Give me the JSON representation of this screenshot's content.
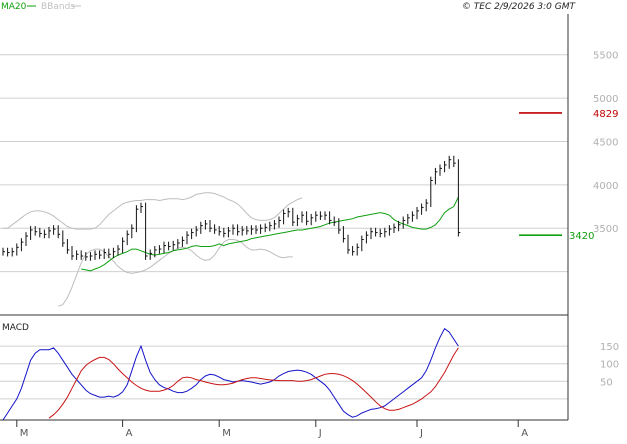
{
  "header": {
    "ma_label": "MA20",
    "bb_label": "BBands",
    "copyright": "© TEC 2/9/2026 3:0 GMT"
  },
  "colors": {
    "price": "#111111",
    "ma20": "#10a010",
    "bbands": "#bdbdbd",
    "resistance": "#c00000",
    "support": "#10a010",
    "grid": "#d0d0d0",
    "axis": "#333333",
    "macd_line": "#1414c8",
    "macd_signal": "#c81414"
  },
  "chart_data": [
    {
      "type": "line",
      "name_label": "price",
      "ylim": [
        2500,
        5900
      ],
      "y_ticks": [
        {
          "value": 5500,
          "label": "5500"
        },
        {
          "value": 5000,
          "label": "5000"
        },
        {
          "value": 4500,
          "label": "4500"
        },
        {
          "value": 4000,
          "label": "4000"
        },
        {
          "value": 3500,
          "label": "3500"
        }
      ],
      "x_ticks": [
        {
          "index": 3,
          "label": "M"
        },
        {
          "index": 26,
          "label": "A"
        },
        {
          "index": 47,
          "label": "M"
        },
        {
          "index": 68,
          "label": "J"
        },
        {
          "index": 90,
          "label": "J"
        },
        {
          "index": 112,
          "label": "A"
        }
      ],
      "price": [
        3230,
        3220,
        3230,
        3280,
        3340,
        3410,
        3480,
        3460,
        3440,
        3430,
        3470,
        3490,
        3430,
        3330,
        3250,
        3180,
        3200,
        3180,
        3170,
        3180,
        3200,
        3190,
        3220,
        3200,
        3230,
        3260,
        3350,
        3430,
        3500,
        3720,
        3750,
        3180,
        3210,
        3250,
        3260,
        3300,
        3290,
        3310,
        3330,
        3360,
        3420,
        3450,
        3480,
        3530,
        3550,
        3500,
        3480,
        3460,
        3440,
        3470,
        3500,
        3460,
        3480,
        3470,
        3490,
        3480,
        3500,
        3510,
        3530,
        3550,
        3590,
        3670,
        3690,
        3570,
        3610,
        3650,
        3580,
        3620,
        3650,
        3640,
        3650,
        3590,
        3570,
        3480,
        3380,
        3250,
        3230,
        3280,
        3370,
        3420,
        3460,
        3450,
        3440,
        3460,
        3490,
        3510,
        3540,
        3590,
        3620,
        3650,
        3700,
        3740,
        3790,
        4050,
        4150,
        4190,
        4230,
        4290,
        4250,
        3450
      ],
      "ma20": [
        3030,
        3020,
        3010,
        3030,
        3050,
        3080,
        3120,
        3160,
        3190,
        3210,
        3230,
        3260,
        3260,
        3240,
        3220,
        3200,
        3190,
        3200,
        3210,
        3220,
        3240,
        3250,
        3260,
        3270,
        3290,
        3300,
        3290,
        3290,
        3290,
        3300,
        3320,
        3300,
        3320,
        3330,
        3340,
        3350,
        3360,
        3380,
        3390,
        3400,
        3410,
        3420,
        3430,
        3440,
        3450,
        3460,
        3470,
        3480,
        3480,
        3490,
        3500,
        3510,
        3520,
        3540,
        3560,
        3570,
        3580,
        3590,
        3600,
        3610,
        3630,
        3640,
        3650,
        3660,
        3670,
        3680,
        3670,
        3650,
        3600,
        3570,
        3550,
        3530,
        3510,
        3500,
        3490,
        3490,
        3510,
        3540,
        3600,
        3680,
        3720,
        3750,
        3860
      ],
      "bb_upper": [
        3500,
        3500,
        3540,
        3580,
        3620,
        3660,
        3690,
        3700,
        3700,
        3690,
        3670,
        3640,
        3600,
        3560,
        3520,
        3500,
        3490,
        3490,
        3490,
        3490,
        3500,
        3540,
        3600,
        3660,
        3700,
        3740,
        3780,
        3800,
        3810,
        3820,
        3820,
        3830,
        3830,
        3830,
        3820,
        3830,
        3840,
        3840,
        3840,
        3830,
        3840,
        3860,
        3890,
        3900,
        3910,
        3910,
        3900,
        3880,
        3860,
        3830,
        3810,
        3780,
        3730,
        3670,
        3620,
        3600,
        3590,
        3590,
        3600,
        3620,
        3670,
        3720,
        3770,
        3800,
        3830,
        3850
      ],
      "bb_lower": [
        2600,
        2620,
        2700,
        2820,
        2960,
        3100,
        3200,
        3240,
        3260,
        3260,
        3230,
        3170,
        3120,
        3060,
        3020,
        2990,
        2980,
        2990,
        3000,
        3020,
        3050,
        3090,
        3130,
        3170,
        3210,
        3240,
        3270,
        3280,
        3270,
        3240,
        3190,
        3150,
        3130,
        3140,
        3190,
        3270,
        3340,
        3370,
        3370,
        3360,
        3330,
        3280,
        3250,
        3250,
        3260,
        3250,
        3230,
        3200,
        3170,
        3160,
        3170,
        3170
      ],
      "levels": [
        {
          "value": 4829,
          "label": "4829",
          "kind": "resistance"
        },
        {
          "value": 3420,
          "label": "3420",
          "kind": "support"
        }
      ]
    },
    {
      "type": "line",
      "title": "MACD",
      "ylim": [
        -60,
        230
      ],
      "y_ticks": [
        {
          "value": 150,
          "label": "150"
        },
        {
          "value": 100,
          "label": "100"
        },
        {
          "value": 50,
          "label": "50"
        }
      ],
      "series": [
        {
          "name": "macd",
          "values": [
            -60,
            -40,
            -20,
            0,
            30,
            70,
            110,
            130,
            140,
            140,
            140,
            145,
            130,
            110,
            90,
            70,
            55,
            40,
            25,
            15,
            10,
            5,
            5,
            8,
            5,
            10,
            20,
            40,
            80,
            120,
            150,
            110,
            75,
            55,
            40,
            32,
            28,
            22,
            18,
            18,
            22,
            30,
            40,
            55,
            65,
            70,
            68,
            62,
            55,
            52,
            48,
            50,
            52,
            50,
            48,
            45,
            42,
            45,
            48,
            55,
            65,
            72,
            78,
            80,
            82,
            80,
            76,
            70,
            60,
            50,
            40,
            25,
            5,
            -15,
            -35,
            -45,
            -52,
            -48,
            -40,
            -35,
            -30,
            -28,
            -25,
            -20,
            -10,
            0,
            10,
            20,
            30,
            40,
            50,
            60,
            80,
            110,
            145,
            175,
            200,
            190,
            170,
            150
          ]
        },
        {
          "name": "signal",
          "values": [
            -55,
            -45,
            -32,
            -15,
            5,
            30,
            55,
            80,
            95,
            105,
            112,
            118,
            118,
            112,
            100,
            85,
            72,
            60,
            48,
            38,
            30,
            25,
            22,
            22,
            22,
            25,
            30,
            38,
            50,
            60,
            62,
            60,
            55,
            52,
            48,
            45,
            42,
            40,
            40,
            42,
            45,
            50,
            55,
            58,
            60,
            60,
            58,
            56,
            54,
            53,
            52,
            52,
            52,
            52,
            50,
            50,
            52,
            55,
            60,
            65,
            70,
            72,
            72,
            70,
            66,
            60,
            52,
            42,
            30,
            18,
            5,
            -8,
            -20,
            -28,
            -32,
            -32,
            -30,
            -25,
            -20,
            -15,
            -8,
            0,
            10,
            20,
            35,
            55,
            75,
            100,
            125,
            145
          ]
        }
      ]
    }
  ]
}
